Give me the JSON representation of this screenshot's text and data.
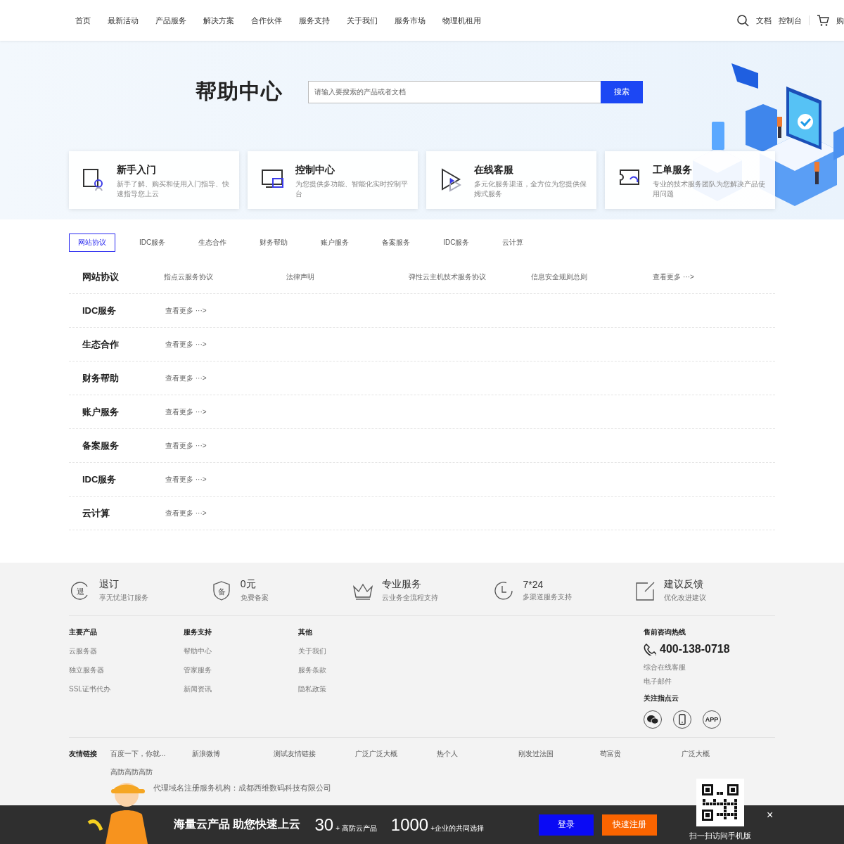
{
  "nav": {
    "items": [
      "首页",
      "最新活动",
      "产品服务",
      "解决方案",
      "合作伙伴",
      "服务支持",
      "关于我们",
      "服务市场",
      "物理机租用"
    ],
    "links": [
      "文档",
      "控制台"
    ],
    "cart": "购"
  },
  "hero": {
    "title": "帮助中心",
    "search": {
      "placeholder": "请输入要搜索的产品或者文档"
    },
    "button": "搜索"
  },
  "cards": [
    {
      "kind": "guide",
      "title": "新手入门",
      "desc": "新手了解、购买和使用入门指导、快速指导您上云"
    },
    {
      "kind": "console",
      "title": "控制中心",
      "desc": "为您提供多功能、智能化实时控制平台"
    },
    {
      "kind": "play",
      "title": "在线客服",
      "desc": "多元化服务渠道，全方位为您提供保姆式服务"
    },
    {
      "kind": "ticket",
      "title": "工单服务",
      "desc": "专业的技术服务团队为您解决产品使用问题"
    }
  ],
  "tabs": [
    {
      "label": "网站协议",
      "selected": true
    },
    {
      "label": "IDC服务",
      "selected": false
    },
    {
      "label": "生态合作",
      "selected": false
    },
    {
      "label": "财务帮助",
      "selected": false
    },
    {
      "label": "账户服务",
      "selected": false
    },
    {
      "label": "备案服务",
      "selected": false
    },
    {
      "label": "IDC服务",
      "selected": false
    },
    {
      "label": "云计算",
      "selected": false
    }
  ],
  "rows": [
    {
      "title": "网站协议",
      "links": [
        "指点云服务协议",
        "法律声明",
        "弹性云主机技术服务协议",
        "信息安全规则总则"
      ],
      "more": "查看更多 ···>"
    },
    {
      "title": "IDC服务",
      "links": [],
      "more": "查看更多 ···>"
    },
    {
      "title": "生态合作",
      "links": [],
      "more": "查看更多 ···>"
    },
    {
      "title": "财务帮助",
      "links": [],
      "more": "查看更多 ···>"
    },
    {
      "title": "账户服务",
      "links": [],
      "more": "查看更多 ···>"
    },
    {
      "title": "备案服务",
      "links": [],
      "more": "查看更多 ···>"
    },
    {
      "title": "IDC服务",
      "links": [],
      "more": "查看更多 ···>"
    },
    {
      "title": "云计算",
      "links": [],
      "more": "查看更多 ···>"
    }
  ],
  "features": [
    {
      "kind": "refund",
      "glyph": "退",
      "title": "退订",
      "sub": "享无忧退订服务"
    },
    {
      "kind": "shield",
      "glyph": "备",
      "title": "0元",
      "sub": "免费备案"
    },
    {
      "kind": "crown",
      "title": "专业服务",
      "sub": "云业务全流程支持"
    },
    {
      "kind": "clock",
      "title": "7*24",
      "sub": "多渠道服务支持"
    },
    {
      "kind": "edit",
      "title": "建议反馈",
      "sub": "优化改进建议"
    }
  ],
  "columns": [
    {
      "heading": "主要产品",
      "links": [
        "云服务器",
        "独立服务器",
        "SSL证书代办"
      ]
    },
    {
      "heading": "服务支持",
      "links": [
        "帮助中心",
        "管家服务",
        "新闻资讯"
      ]
    },
    {
      "heading": "其他",
      "links": [
        "关于我们",
        "服务条款",
        "隐私政策"
      ]
    }
  ],
  "contact": {
    "heading": "售前咨询热线",
    "phone": "400-138-0718",
    "links": [
      "综合在线客服",
      "电子邮件"
    ],
    "follow": "关注指点云",
    "social": [
      {
        "kind": "wechat"
      },
      {
        "kind": "mobile"
      },
      {
        "kind": "text",
        "label": "APP"
      }
    ]
  },
  "friends": {
    "label": "友情链接",
    "items": [
      "百度一下，你就...",
      "新浪微博",
      "测试友情链接",
      "广泛广泛大概",
      "热个人",
      "刚发过法国",
      "苟富贵",
      "广泛大概",
      "高防高防高防"
    ]
  },
  "copyright": "代理域名注册服务机构：成都西维数码科技有限公司",
  "bar": {
    "slogan": "海量云产品 助您快速上云",
    "stats": [
      {
        "num": "30",
        "label": "+ 高防云产品"
      },
      {
        "num": "1000",
        "label": "+企业的共同选择"
      }
    ],
    "login": "登录",
    "register": "快速注册",
    "qr_caption": "扫一扫访问手机版",
    "close": "×"
  }
}
